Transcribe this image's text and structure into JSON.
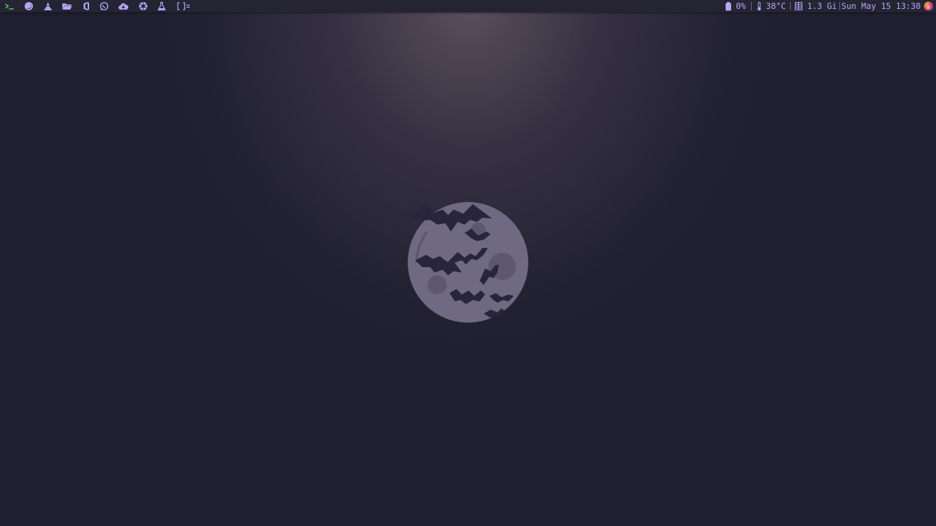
{
  "colors": {
    "bar_bg": "#252433",
    "accent": "#b6a6f5",
    "terminal_green": "#3fd46c",
    "desktop_bg": "#1f1f30",
    "moon": "#6f6a82",
    "bats": "#25243a"
  },
  "launchers": [
    {
      "name": "terminal-icon"
    },
    {
      "name": "firefox-icon"
    },
    {
      "name": "vlc-icon"
    },
    {
      "name": "files-icon"
    },
    {
      "name": "office-icon"
    },
    {
      "name": "whatsapp-icon"
    },
    {
      "name": "cloud-download-icon"
    },
    {
      "name": "aperture-icon"
    },
    {
      "name": "flask-icon"
    },
    {
      "name": "layout-icon"
    }
  ],
  "status": {
    "battery": "0%",
    "temperature": "38°C",
    "memory": "1.3 Gi",
    "datetime": "Sun May 15 13:30"
  },
  "wallpaper": {
    "icon": "moon-bats-logo"
  }
}
